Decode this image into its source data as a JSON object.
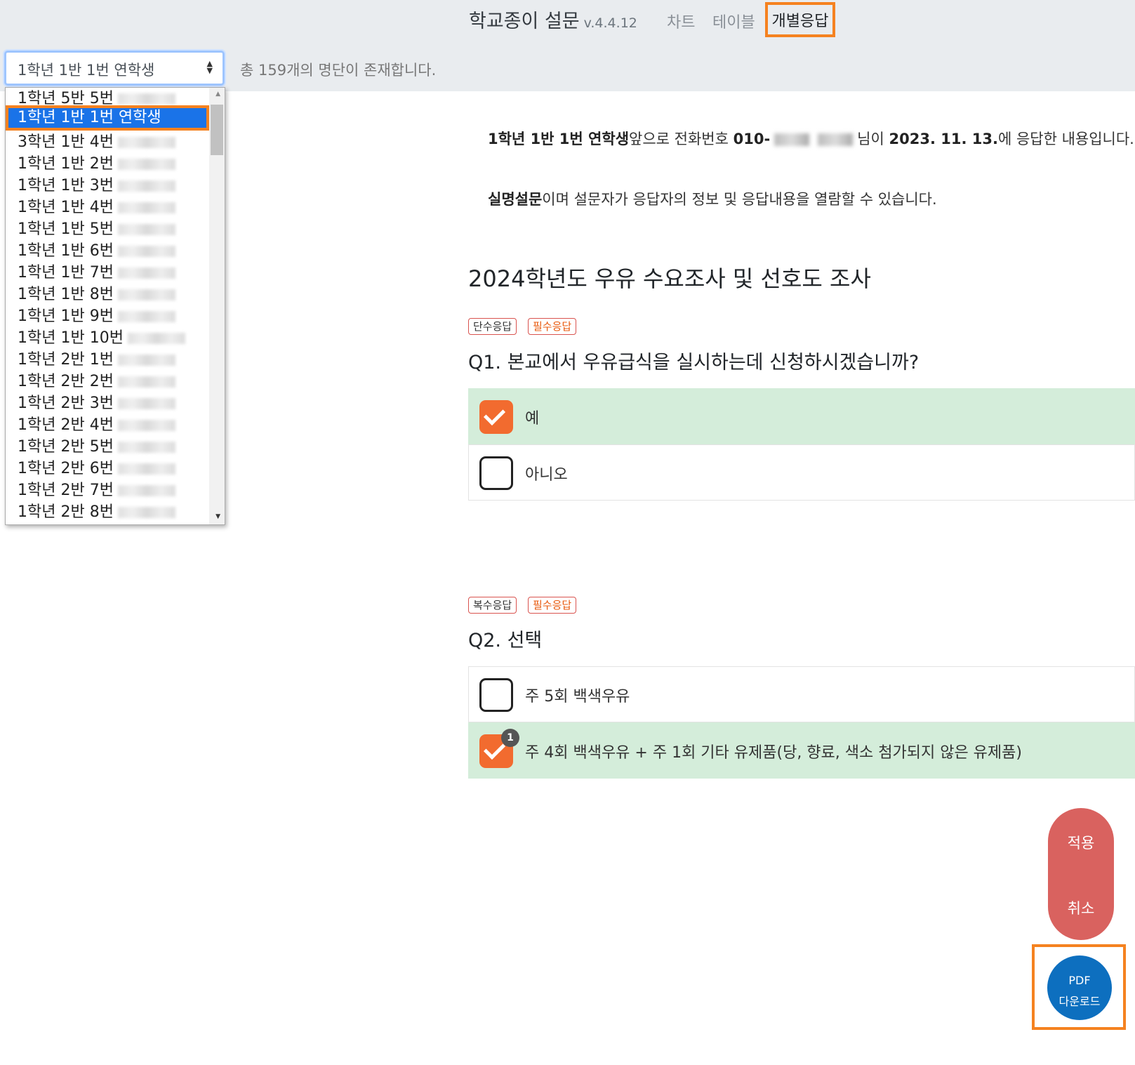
{
  "header": {
    "title": "학교종이 설문",
    "version": "v.4.4.12",
    "tabs": [
      "차트",
      "테이블",
      "개별응답"
    ],
    "active_tab": "개별응답"
  },
  "respondent_select": {
    "selected": "1학년 1반 1번 연학생",
    "options": [
      "1학년 5반 5번",
      "1학년 1반 1번 연학생",
      "3학년 1반 4번",
      "1학년 1반 2번",
      "1학년 1반 3번",
      "1학년 1반 4번",
      "1학년 1반 5번",
      "1학년 1반 6번",
      "1학년 1반 7번",
      "1학년 1반 8번",
      "1학년 1반 9번",
      "1학년 1반 10번",
      "1학년 2반 1번",
      "1학년 2반 2번",
      "1학년 2반 3번",
      "1학년 2반 4번",
      "1학년 2반 5번",
      "1학년 2반 6번",
      "1학년 2반 7번",
      "1학년 2반 8번"
    ],
    "highlighted_index": 1
  },
  "list_count": "총 159개의 명단이 존재합니다.",
  "info": {
    "name": "1학년 1반 1번 연학생",
    "text1": "앞으로 전화번호 ",
    "phone_prefix": "010-",
    "text2": "님이 ",
    "date": "2023. 11. 13.",
    "text3": "에 응답한 내용입니다.",
    "mode": "실명설문",
    "text4": "이며 설문자가 응답자의 정보 및 응답내용을 열람할 수 있습니다."
  },
  "survey": {
    "title": "2024학년도 우유 수요조사 및 선호도 조사",
    "questions": [
      {
        "type_badge": "단수응답",
        "required_badge": "필수응답",
        "text": "Q1. 본교에서 우유급식을 실시하는데 신청하시겠습니까?",
        "options": [
          {
            "label": "예",
            "checked": true
          },
          {
            "label": "아니오",
            "checked": false
          }
        ]
      },
      {
        "type_badge": "복수응답",
        "required_badge": "필수응답",
        "text": "Q2. 선택",
        "options": [
          {
            "label": "주 5회 백색우유",
            "checked": false
          },
          {
            "label": "주 4회 백색우유 + 주 1회 기타 유제품(당, 향료, 색소 첨가되지 않은 유제품)",
            "checked": true,
            "order": "1"
          }
        ]
      }
    ]
  },
  "actions": {
    "apply": "적용",
    "cancel": "취소",
    "pdf_line1": "PDF",
    "pdf_line2": "다운로드"
  },
  "colors": {
    "accent_orange": "#f58220",
    "checkbox_on": "#f26b2f",
    "selected_row": "#d4edda",
    "pill": "#d9625f",
    "pdf": "#0d6fbf"
  }
}
